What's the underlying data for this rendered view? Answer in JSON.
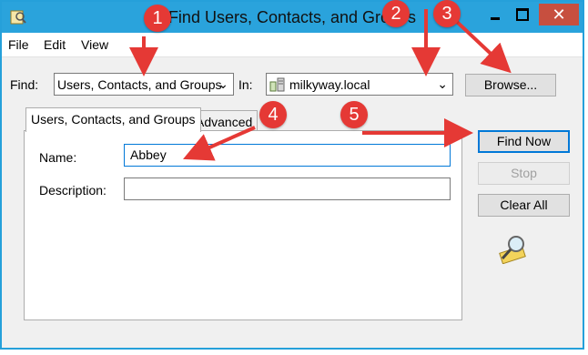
{
  "window": {
    "title": "Find Users, Contacts, and Groups"
  },
  "menu": [
    "File",
    "Edit",
    "View"
  ],
  "find": {
    "label": "Find:",
    "value": "Users, Contacts, and Groups"
  },
  "in": {
    "label": "In:",
    "value": "milkyway.local"
  },
  "buttons": {
    "browse": "Browse...",
    "find_now": "Find Now",
    "stop": "Stop",
    "clear_all": "Clear All"
  },
  "tabs": [
    "Users, Contacts, and Groups",
    "Advanced"
  ],
  "fields": {
    "name": {
      "label": "Name:",
      "value": "Abbey"
    },
    "description": {
      "label": "Description:",
      "value": ""
    }
  },
  "annotations": [
    "1",
    "2",
    "3",
    "4",
    "5"
  ],
  "colors": {
    "title_bar": "#2aa3dc",
    "close_button": "#c74f3f",
    "annotation": "#e53935"
  },
  "icons": [
    "find-users-app-icon",
    "minimize-icon",
    "maximize-icon",
    "close-icon",
    "domain-network-icon",
    "dropdown-arrow-icon",
    "search-magnifier-icon"
  ]
}
